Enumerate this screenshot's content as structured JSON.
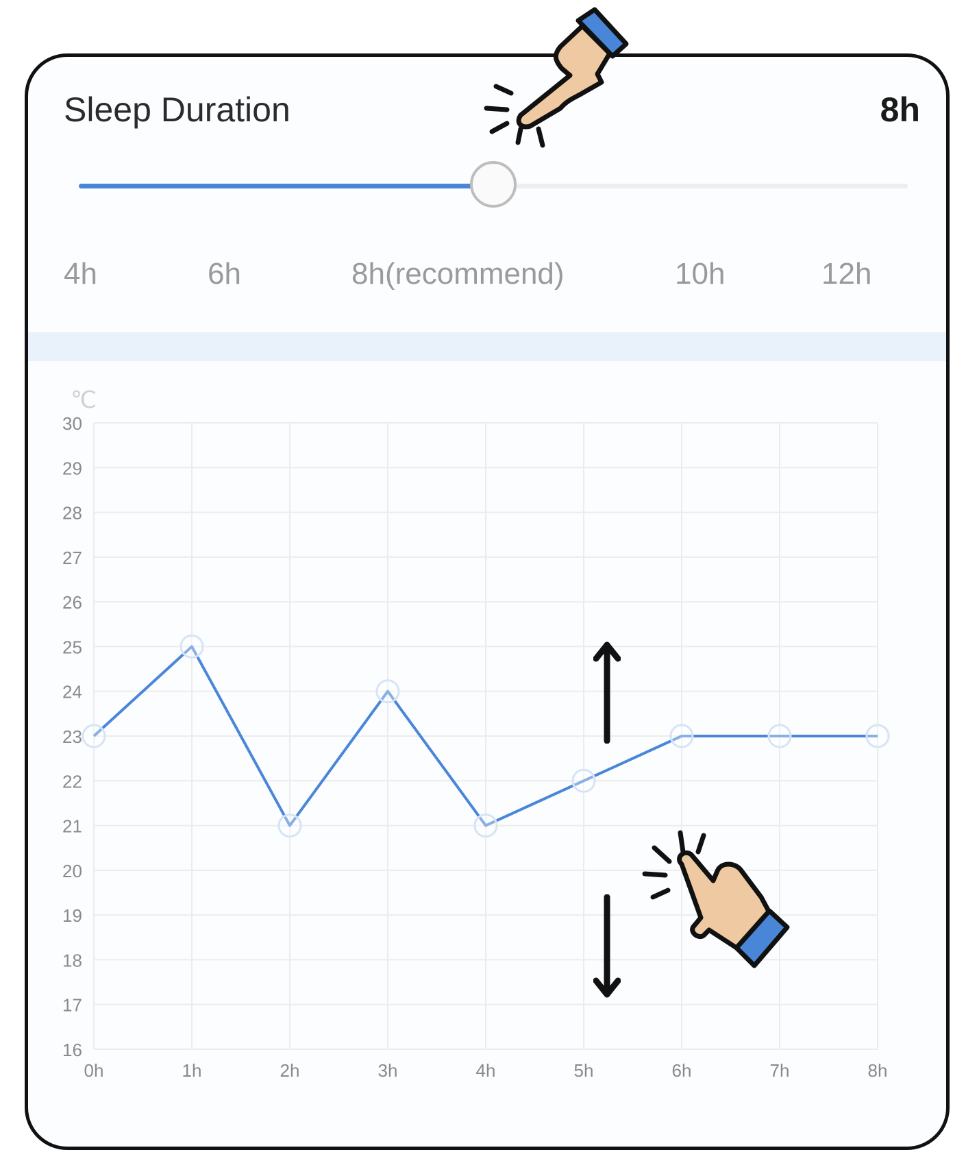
{
  "slider": {
    "title": "Sleep Duration",
    "value_label": "8h",
    "value_hours": 8,
    "range_hours": [
      4,
      12
    ],
    "ticks": [
      "4h",
      "6h",
      "8h(recommend)",
      "10h",
      "12h"
    ],
    "colors": {
      "fill": "#4a86d8",
      "track": "#eeeeee"
    }
  },
  "chart_data": {
    "type": "line",
    "ylabel": "℃",
    "ylim": [
      16,
      30
    ],
    "yticks": [
      "30",
      "29",
      "28",
      "27",
      "26",
      "25",
      "24",
      "23",
      "22",
      "21",
      "20",
      "19",
      "18",
      "17",
      "16"
    ],
    "categories": [
      "0h",
      "1h",
      "2h",
      "3h",
      "4h",
      "5h",
      "6h",
      "7h",
      "8h"
    ],
    "series": [
      {
        "values": [
          23,
          25,
          21,
          24,
          21,
          22,
          23,
          23,
          23
        ],
        "color": "#4a86d8"
      }
    ],
    "grid": true
  },
  "overlays": {
    "icons": [
      "tap-hand-icon",
      "tap-hand-icon",
      "arrow-up-icon",
      "arrow-down-icon"
    ]
  }
}
